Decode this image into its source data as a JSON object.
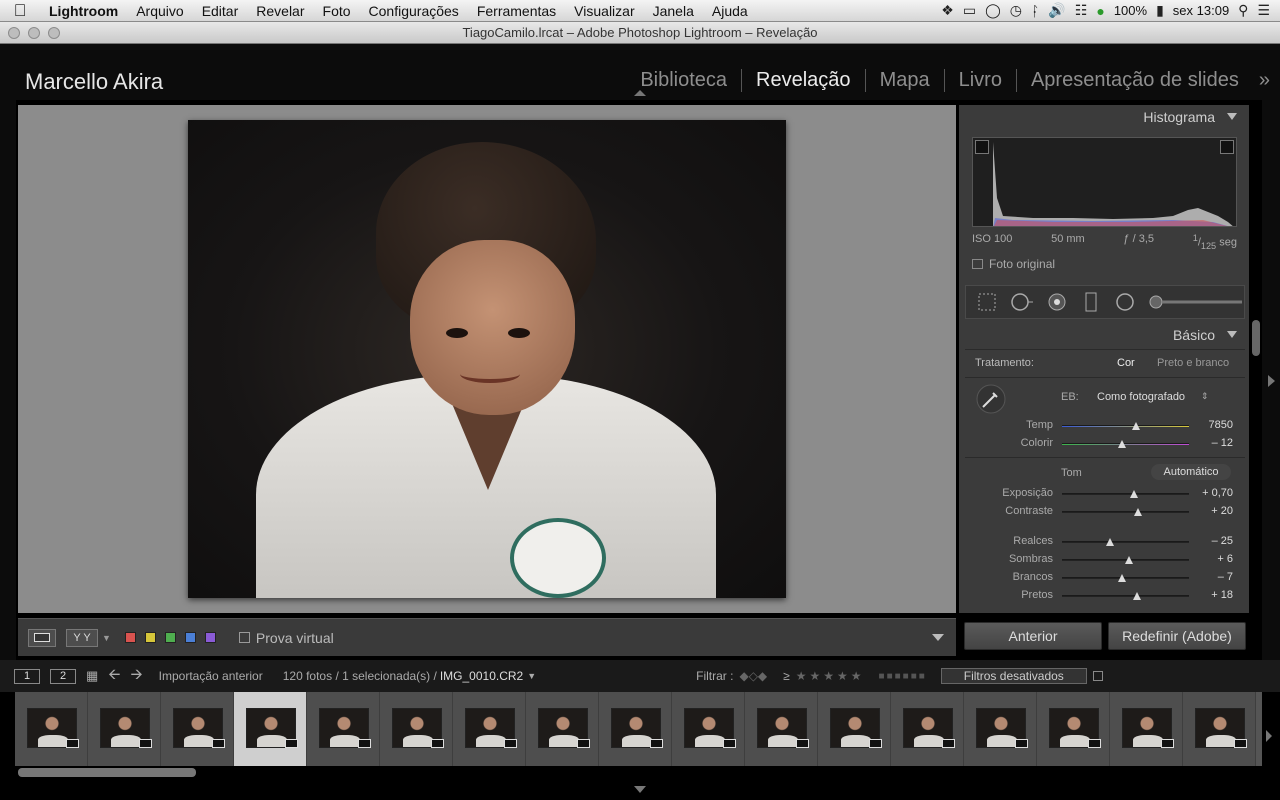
{
  "menubar": {
    "app": "Lightroom",
    "items": [
      "Arquivo",
      "Editar",
      "Revelar",
      "Foto",
      "Configurações",
      "Ferramentas",
      "Visualizar",
      "Janela",
      "Ajuda"
    ],
    "battery": "100%",
    "clock": "sex 13:09"
  },
  "window": {
    "title": "TiagoCamilo.lrcat – Adobe Photoshop Lightroom – Revelação"
  },
  "header": {
    "identity": "Marcello Akira",
    "modules": [
      "Biblioteca",
      "Revelação",
      "Mapa",
      "Livro",
      "Apresentação de slides"
    ],
    "active_module": "Revelação",
    "more": "»"
  },
  "toolbar": {
    "view_button": "Y Y",
    "colors": [
      "#d9534f",
      "#d6c63a",
      "#4fae4f",
      "#4b7fd6",
      "#8a5bd6"
    ],
    "soft_proof_label": "Prova virtual"
  },
  "panel": {
    "histogram_title": "Histograma",
    "exif": {
      "iso": "ISO 100",
      "focal": "50 mm",
      "aperture": "ƒ / 3,5",
      "shutter_num": "1",
      "shutter_den": "125",
      "shutter_unit": "seg"
    },
    "original_label": "Foto original",
    "basic_title": "Básico",
    "treatment_label": "Tratamento:",
    "treatment_color": "Cor",
    "treatment_bw": "Preto e branco",
    "wb_label": "EB:",
    "wb_value": "Como fotografado",
    "tone_label": "Tom",
    "auto_label": "Automático",
    "sliders": [
      {
        "label": "Temp",
        "value": "7850",
        "pos": 0.58
      },
      {
        "label": "Colorir",
        "value": "– 12",
        "pos": 0.47
      },
      {
        "label": "Exposição",
        "value": "+ 0,70",
        "pos": 0.57
      },
      {
        "label": "Contraste",
        "value": "+ 20",
        "pos": 0.6
      },
      {
        "label": "Realces",
        "value": "– 25",
        "pos": 0.38
      },
      {
        "label": "Sombras",
        "value": "+ 6",
        "pos": 0.53
      },
      {
        "label": "Brancos",
        "value": "– 7",
        "pos": 0.47
      },
      {
        "label": "Pretos",
        "value": "+ 18",
        "pos": 0.59
      }
    ],
    "btn_previous": "Anterior",
    "btn_reset": "Redefinir (Adobe)"
  },
  "filmbar": {
    "screen1": "1",
    "screen2": "2",
    "source": "Importação anterior",
    "count": "120 fotos / 1 selecionada(s) /",
    "filename": "IMG_0010.CR2",
    "filter_label": "Filtrar :",
    "filter_gte": "≥",
    "filters_off": "Filtros desativados"
  },
  "filmstrip": {
    "selected_index": 3,
    "count_visible": 17
  }
}
